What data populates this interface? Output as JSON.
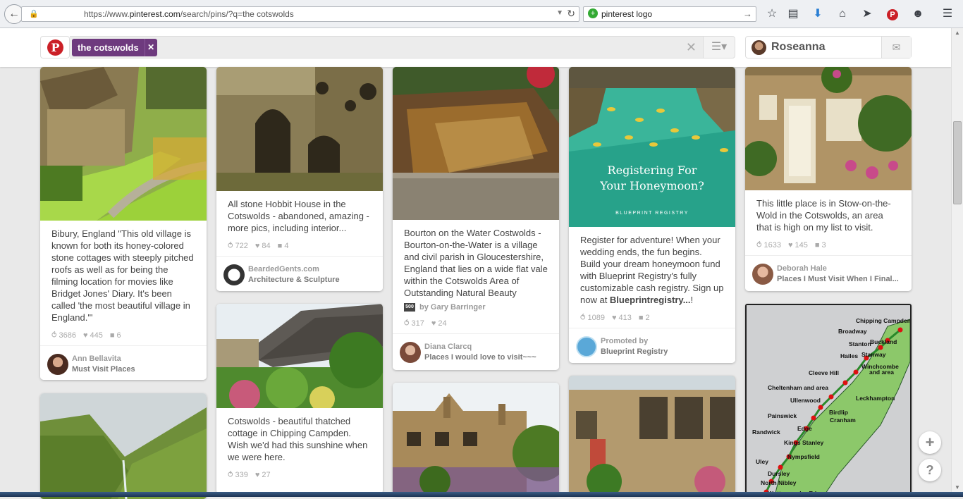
{
  "browser": {
    "url_prefix": "https://www.",
    "url_domain": "pinterest.com",
    "url_path": "/search/pins/?q=the cotswolds",
    "search_text": "pinterest logo",
    "icons": [
      "star-icon",
      "reader-icon",
      "download-icon",
      "home-icon",
      "send-icon",
      "pinterest-icon",
      "smiley-icon",
      "menu-icon"
    ]
  },
  "header": {
    "search_chip": "the cotswolds",
    "user_name": "Roseanna"
  },
  "pins": [
    {
      "desc": "Bibury, England \"This old village is known for both its honey-colored stone cottages with steeply pitched roofs as well as for being the filming location for movies like Bridget Jones' Diary. It's been called 'the most beautiful village in England.'\"",
      "repins": "3686",
      "likes": "445",
      "comments": "6",
      "user": "Ann Bellavita",
      "board": "Must Visit Places"
    },
    {
      "desc": "All stone Hobbit House in the Cotswolds - abandoned, amazing - more pics, including interior...",
      "repins": "722",
      "likes": "84",
      "comments": "4",
      "user": "BeardedGents.com",
      "board": "Architecture & Sculpture"
    },
    {
      "desc": "Bourton on the Water Costwolds - Bourton-on-the-Water is a village and civil parish in Gloucestershire, England that lies on a wide flat vale within the Cotswolds Area of Outstanding Natural Beauty",
      "via": "by Gary Barringer",
      "repins": "317",
      "likes": "24",
      "user": "Diana Clarcq",
      "board": "Places I would love to visit~~~"
    },
    {
      "img_text_1": "Registering For",
      "img_text_2": "Your Honeymoon?",
      "img_brand": "BLUEPRINT   REGISTRY",
      "desc_a": "Register for adventure! When your wedding ends, the fun begins. Build your dream honeymoon fund with Blueprint Registry's fully customizable cash registry. Sign up now at ",
      "desc_b": "Blueprintregistry...",
      "desc_c": "!",
      "repins": "1089",
      "likes": "413",
      "comments": "2",
      "user": "Promoted by",
      "board": "Blueprint Registry"
    },
    {
      "desc": "This little place is in Stow-on-the-Wold in the Cotswolds, an area that is high on my list to visit.",
      "repins": "1633",
      "likes": "145",
      "comments": "3",
      "user": "Deborah Hale",
      "board": "Places I Must Visit When I Final..."
    },
    {
      "desc": "Cotswolds - beautiful thatched cottage in Chipping Campden. Wish we'd had this sunshine when we were here.",
      "repins": "339",
      "likes": "27"
    }
  ],
  "map_labels": [
    "Chipping Campden",
    "Broadway",
    "Buckland",
    "Stanton",
    "Hailes",
    "Stanway",
    "Winchcombe",
    "and area",
    "Cleeve Hill",
    "Cheltenham and area",
    "Leckhampton",
    "Ullenwood",
    "Birdlip",
    "Painswick",
    "Cranham",
    "Randwick",
    "Edge",
    "Kings Stanley",
    "Nympsfield",
    "Uley",
    "Dursley",
    "North Nibley",
    "Wotton-under-Edge"
  ],
  "floating": {
    "add": "+",
    "help": "?"
  }
}
